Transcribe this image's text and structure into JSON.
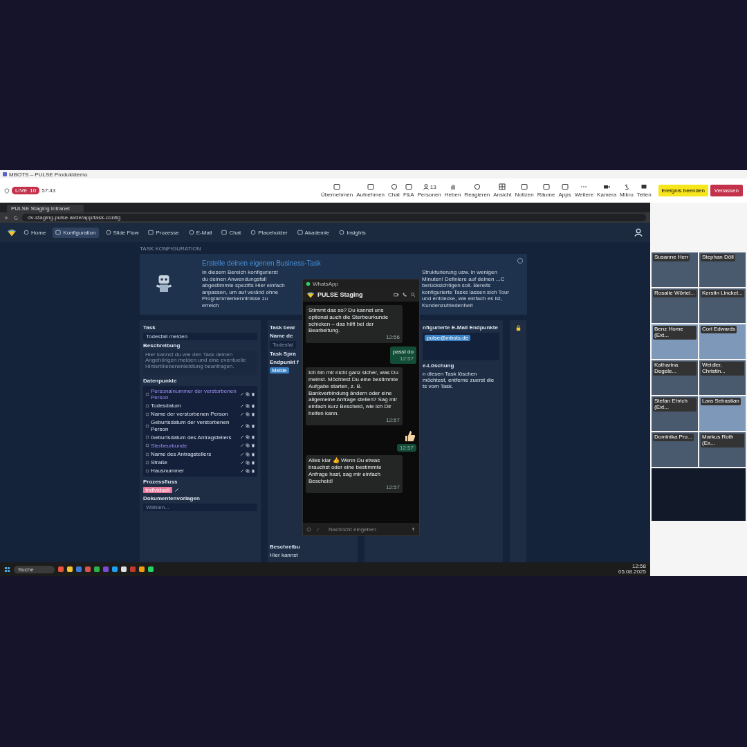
{
  "meeting": {
    "title": "MBOTS – PULSE Produktdemo",
    "live_label": "LIVE",
    "viewer_count": "10",
    "elapsed": "57:43"
  },
  "toolbar": [
    {
      "label": "Übernehmen"
    },
    {
      "label": "Aufnehmen"
    },
    {
      "label": "Chat"
    },
    {
      "label": "F&A"
    },
    {
      "label": "Personen",
      "count": "13"
    },
    {
      "label": "Heben"
    },
    {
      "label": "Reagieren"
    },
    {
      "label": "Ansicht"
    },
    {
      "label": "Notizen"
    },
    {
      "label": "Räume"
    },
    {
      "label": "Apps"
    },
    {
      "label": "Weitere"
    },
    {
      "label": "Kamera"
    },
    {
      "label": "Mikro"
    },
    {
      "label": "Teilen"
    }
  ],
  "end_button": "Ereignis beenden",
  "leave_button": "Verlassen",
  "browser": {
    "tab_title": "PULSE Staging Intranet",
    "url": "dv-staging.pulse.ai/de/app/task-config"
  },
  "app_nav": [
    {
      "label": "Home",
      "selected": false
    },
    {
      "label": "Konfiguration",
      "selected": true
    },
    {
      "label": "Slide Flow",
      "selected": false
    },
    {
      "label": "Prozesse",
      "selected": false
    },
    {
      "label": "E-Mail",
      "selected": false
    },
    {
      "label": "Chat",
      "selected": false
    },
    {
      "label": "Placeholder",
      "selected": false
    },
    {
      "label": "Akademie",
      "selected": false
    },
    {
      "label": "Insights",
      "selected": false
    }
  ],
  "page": {
    "section_label": "TASK KONFIGURATION",
    "banner_title": "Erstelle deinen eigenen Business-Task",
    "banner_text_left": "In diesem Bereich konfigurierst du deinen Anwendungsfall abgestimmte spezifis Hier einfach anpassen, um auf veränd ohne Programmierkenntnisse zu erreich",
    "banner_text_right": "Strukturierung usw. in wenigen Minuten! Definiere auf deinen ...C berücksichtigen soll. Bereits konfigurierte Tasks lassen sich Tour und entdecke, wie einfach es ist, Kundenzufriedenheit",
    "task": {
      "title": "Task",
      "select_value": "Todesfall melden",
      "description_label": "Beschreibung",
      "description_text": "Hier kannst du wie den Task deinen Angehörigen melden und eine eventuelle Hinterbliebenenleistung beantragen.",
      "datapoints_label": "Datenpunkte",
      "datapoints": [
        {
          "label": "Personalnummer der verstorbenen Person",
          "highlighted": true
        },
        {
          "label": "Todesdatum",
          "highlighted": false
        },
        {
          "label": "Name der verstorbenen Person",
          "highlighted": false
        },
        {
          "label": "Geburtsdatum der verstorbenen Person",
          "highlighted": false
        },
        {
          "label": "Geburtsdatum des Antragstellers",
          "highlighted": false
        },
        {
          "label": "Sterbeurkunde",
          "highlighted": true
        },
        {
          "label": "Name des Antragstellers",
          "highlighted": false
        },
        {
          "label": "Straße",
          "highlighted": false
        },
        {
          "label": "Hausnummer",
          "highlighted": false
        }
      ],
      "process_label": "Prozessfluss",
      "process_tag": "Individuell",
      "templates_label": "Dokumentenvorlagen",
      "templates_placeholder": "Wählen..."
    },
    "edit": {
      "title": "Task bear",
      "name_label": "Name de",
      "name_value": "Todesfal",
      "language_label": "Task Spra",
      "endpoint_label": "Endpunkt f",
      "endpoint_chip": "Melde",
      "desc_label": "Beschreibu",
      "desc_text": "Hier kannst"
    },
    "mail": {
      "title": "nfigurierte E-Mail Endpunkte",
      "chip": "pulse@mbots.de",
      "delete_label": "e-Löschung",
      "delete_text": "n diesen Task löschen möchtest, entferne zuerst die ts vom Task."
    }
  },
  "whatsapp": {
    "app_title": "WhatsApp",
    "chat_name": "PULSE Staging",
    "messages": [
      {
        "kind": "in",
        "text": "Stimmt das so? Du kannst uns optional auch die Sterbeurkunde schicken – das hilft bei der Bearbeitung.",
        "time": "12:56"
      },
      {
        "kind": "out",
        "text": "passt do",
        "time": "12:57"
      },
      {
        "kind": "in",
        "text": "Ich bin mir nicht ganz sicher, was Du meinst. Möchtest Du eine bestimmte Aufgabe starten, z. B. Bankverbindung ändern oder eine allgemeine Anfrage stellen? Sag mir einfach kurz Bescheid, wie ich Dir helfen kann.",
        "time": "12:57"
      },
      {
        "kind": "sticker",
        "time": "12:57"
      },
      {
        "kind": "in",
        "text": "Alles klar 👍 Wenn Du etwas brauchst oder eine bestimmte Anfrage hast, sag mir einfach Bescheid!",
        "time": "12:57"
      }
    ],
    "input_placeholder": "Nachricht eingeben"
  },
  "participants": [
    {
      "name": "Susanne Herr"
    },
    {
      "name": "Stephan Döll"
    },
    {
      "name": "Rosalie Wörtel..."
    },
    {
      "name": "Kerstin Linckel..."
    },
    {
      "name": "Benz Home (Ext..."
    },
    {
      "name": "Cori Edwards"
    },
    {
      "name": "Katharina Degele..."
    },
    {
      "name": "Weidler, Christin..."
    },
    {
      "name": "Stefan Ehrich (Ext..."
    },
    {
      "name": "Lara Sebastian"
    },
    {
      "name": "Dominika Pro..."
    },
    {
      "name": "Markus Roth (Ex..."
    }
  ],
  "taskbar": {
    "search_placeholder": "Suche",
    "time": "12:58",
    "date": "05.08.2025"
  }
}
